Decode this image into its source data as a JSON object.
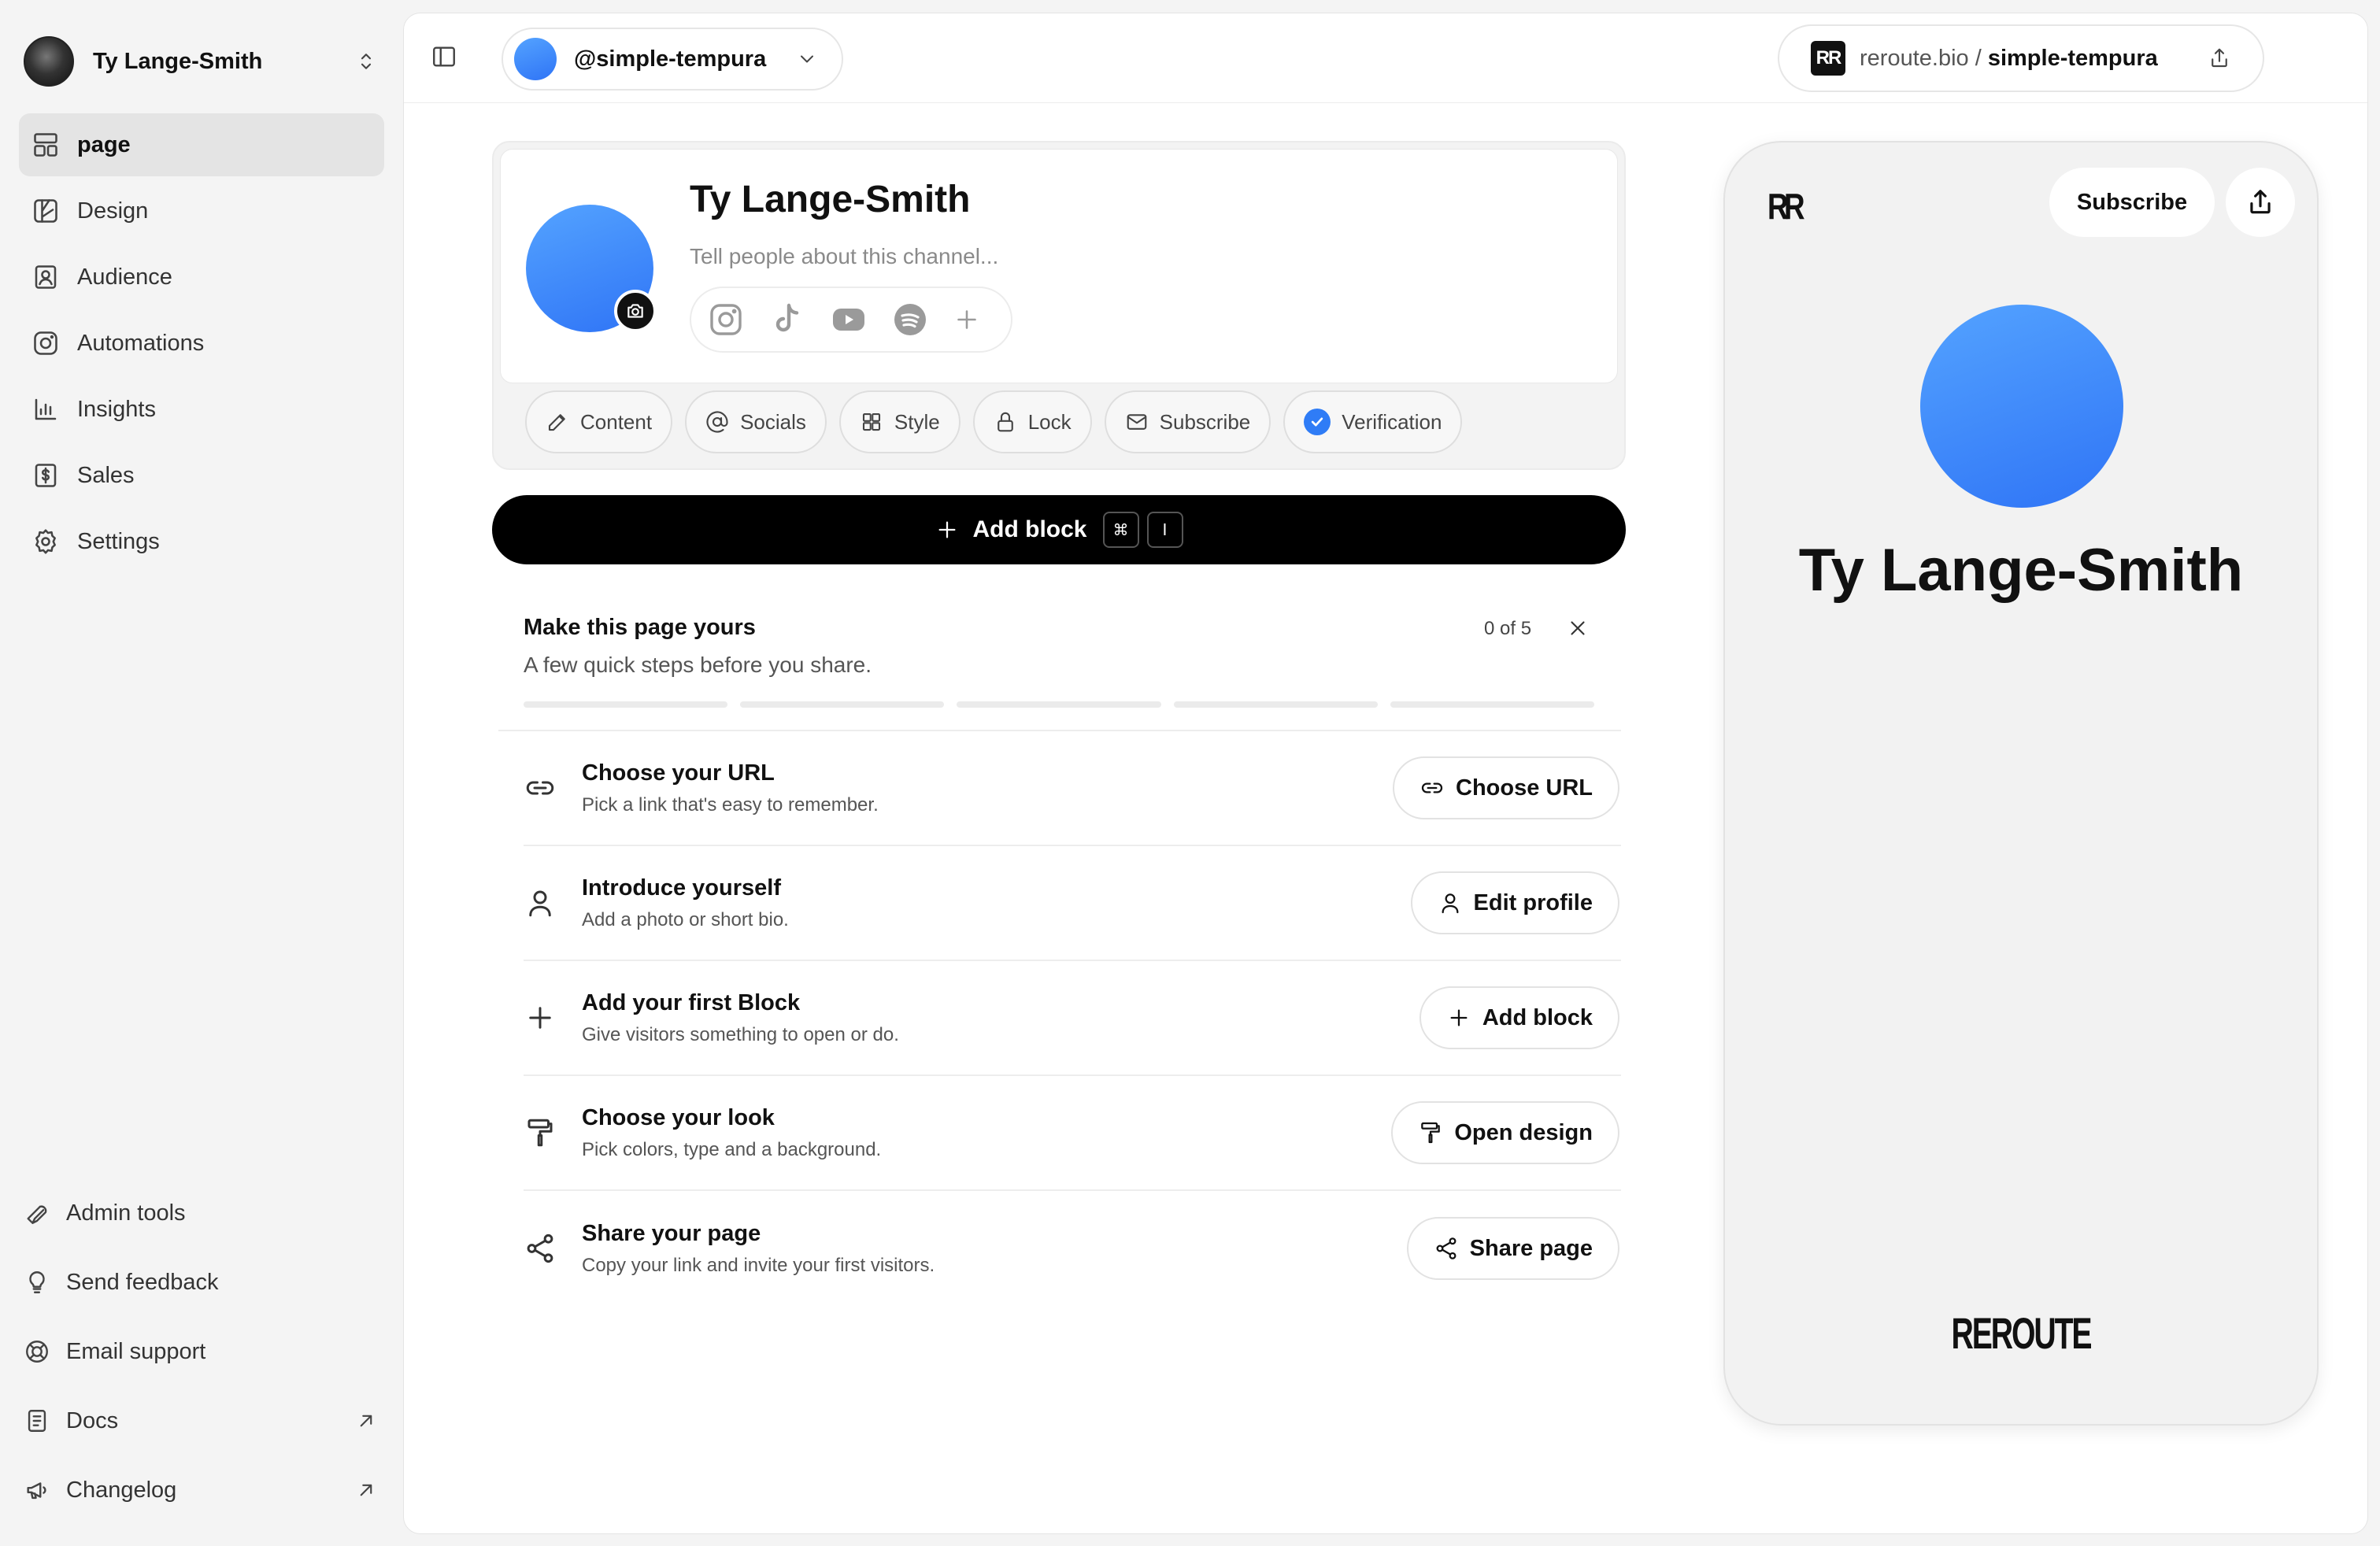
{
  "account": {
    "name": "Ty Lange-Smith"
  },
  "nav": [
    {
      "label": "page",
      "icon": "layout-icon",
      "active": true
    },
    {
      "label": "Design",
      "icon": "design-icon"
    },
    {
      "label": "Audience",
      "icon": "audience-icon"
    },
    {
      "label": "Automations",
      "icon": "instagram-icon"
    },
    {
      "label": "Insights",
      "icon": "chart-icon"
    },
    {
      "label": "Sales",
      "icon": "dollar-icon"
    },
    {
      "label": "Settings",
      "icon": "gear-icon"
    }
  ],
  "bottom_nav": [
    {
      "label": "Admin tools"
    },
    {
      "label": "Send feedback"
    },
    {
      "label": "Email support"
    },
    {
      "label": "Docs"
    },
    {
      "label": "Changelog"
    }
  ],
  "topbar": {
    "handle": "@simple-tempura",
    "url_domain": "reroute.bio",
    "url_sep": " / ",
    "url_slug": "simple-tempura",
    "logo_text": "RR"
  },
  "profile": {
    "name": "Ty Lange-Smith",
    "bio_placeholder": "Tell people about this channel..."
  },
  "tools": [
    "Content",
    "Socials",
    "Style",
    "Lock",
    "Subscribe",
    "Verification"
  ],
  "add_block": {
    "label": "Add block",
    "kbd1": "⌘",
    "kbd2": "I"
  },
  "checklist": {
    "title": "Make this page yours",
    "subtitle": "A few quick steps before you share.",
    "count": "0 of 5",
    "progress": 0,
    "steps": [
      {
        "title": "Choose your URL",
        "desc": "Pick a link that's easy to remember.",
        "button": "Choose URL"
      },
      {
        "title": "Introduce yourself",
        "desc": "Add a photo or short bio.",
        "button": "Edit profile"
      },
      {
        "title": "Add your first Block",
        "desc": "Give visitors something to open or do.",
        "button": "Add block"
      },
      {
        "title": "Choose your look",
        "desc": "Pick colors, type and a background.",
        "button": "Open design"
      },
      {
        "title": "Share your page",
        "desc": "Copy your link and invite your first visitors.",
        "button": "Share page"
      }
    ]
  },
  "preview": {
    "logo": "RR",
    "subscribe": "Subscribe",
    "name": "Ty Lange-Smith",
    "footer_logo": "REROUTE"
  },
  "colors": {
    "accent": "#2f7cf6",
    "avatar_gradient_start": "#54a3ff",
    "avatar_gradient_end": "#2f74f6"
  }
}
